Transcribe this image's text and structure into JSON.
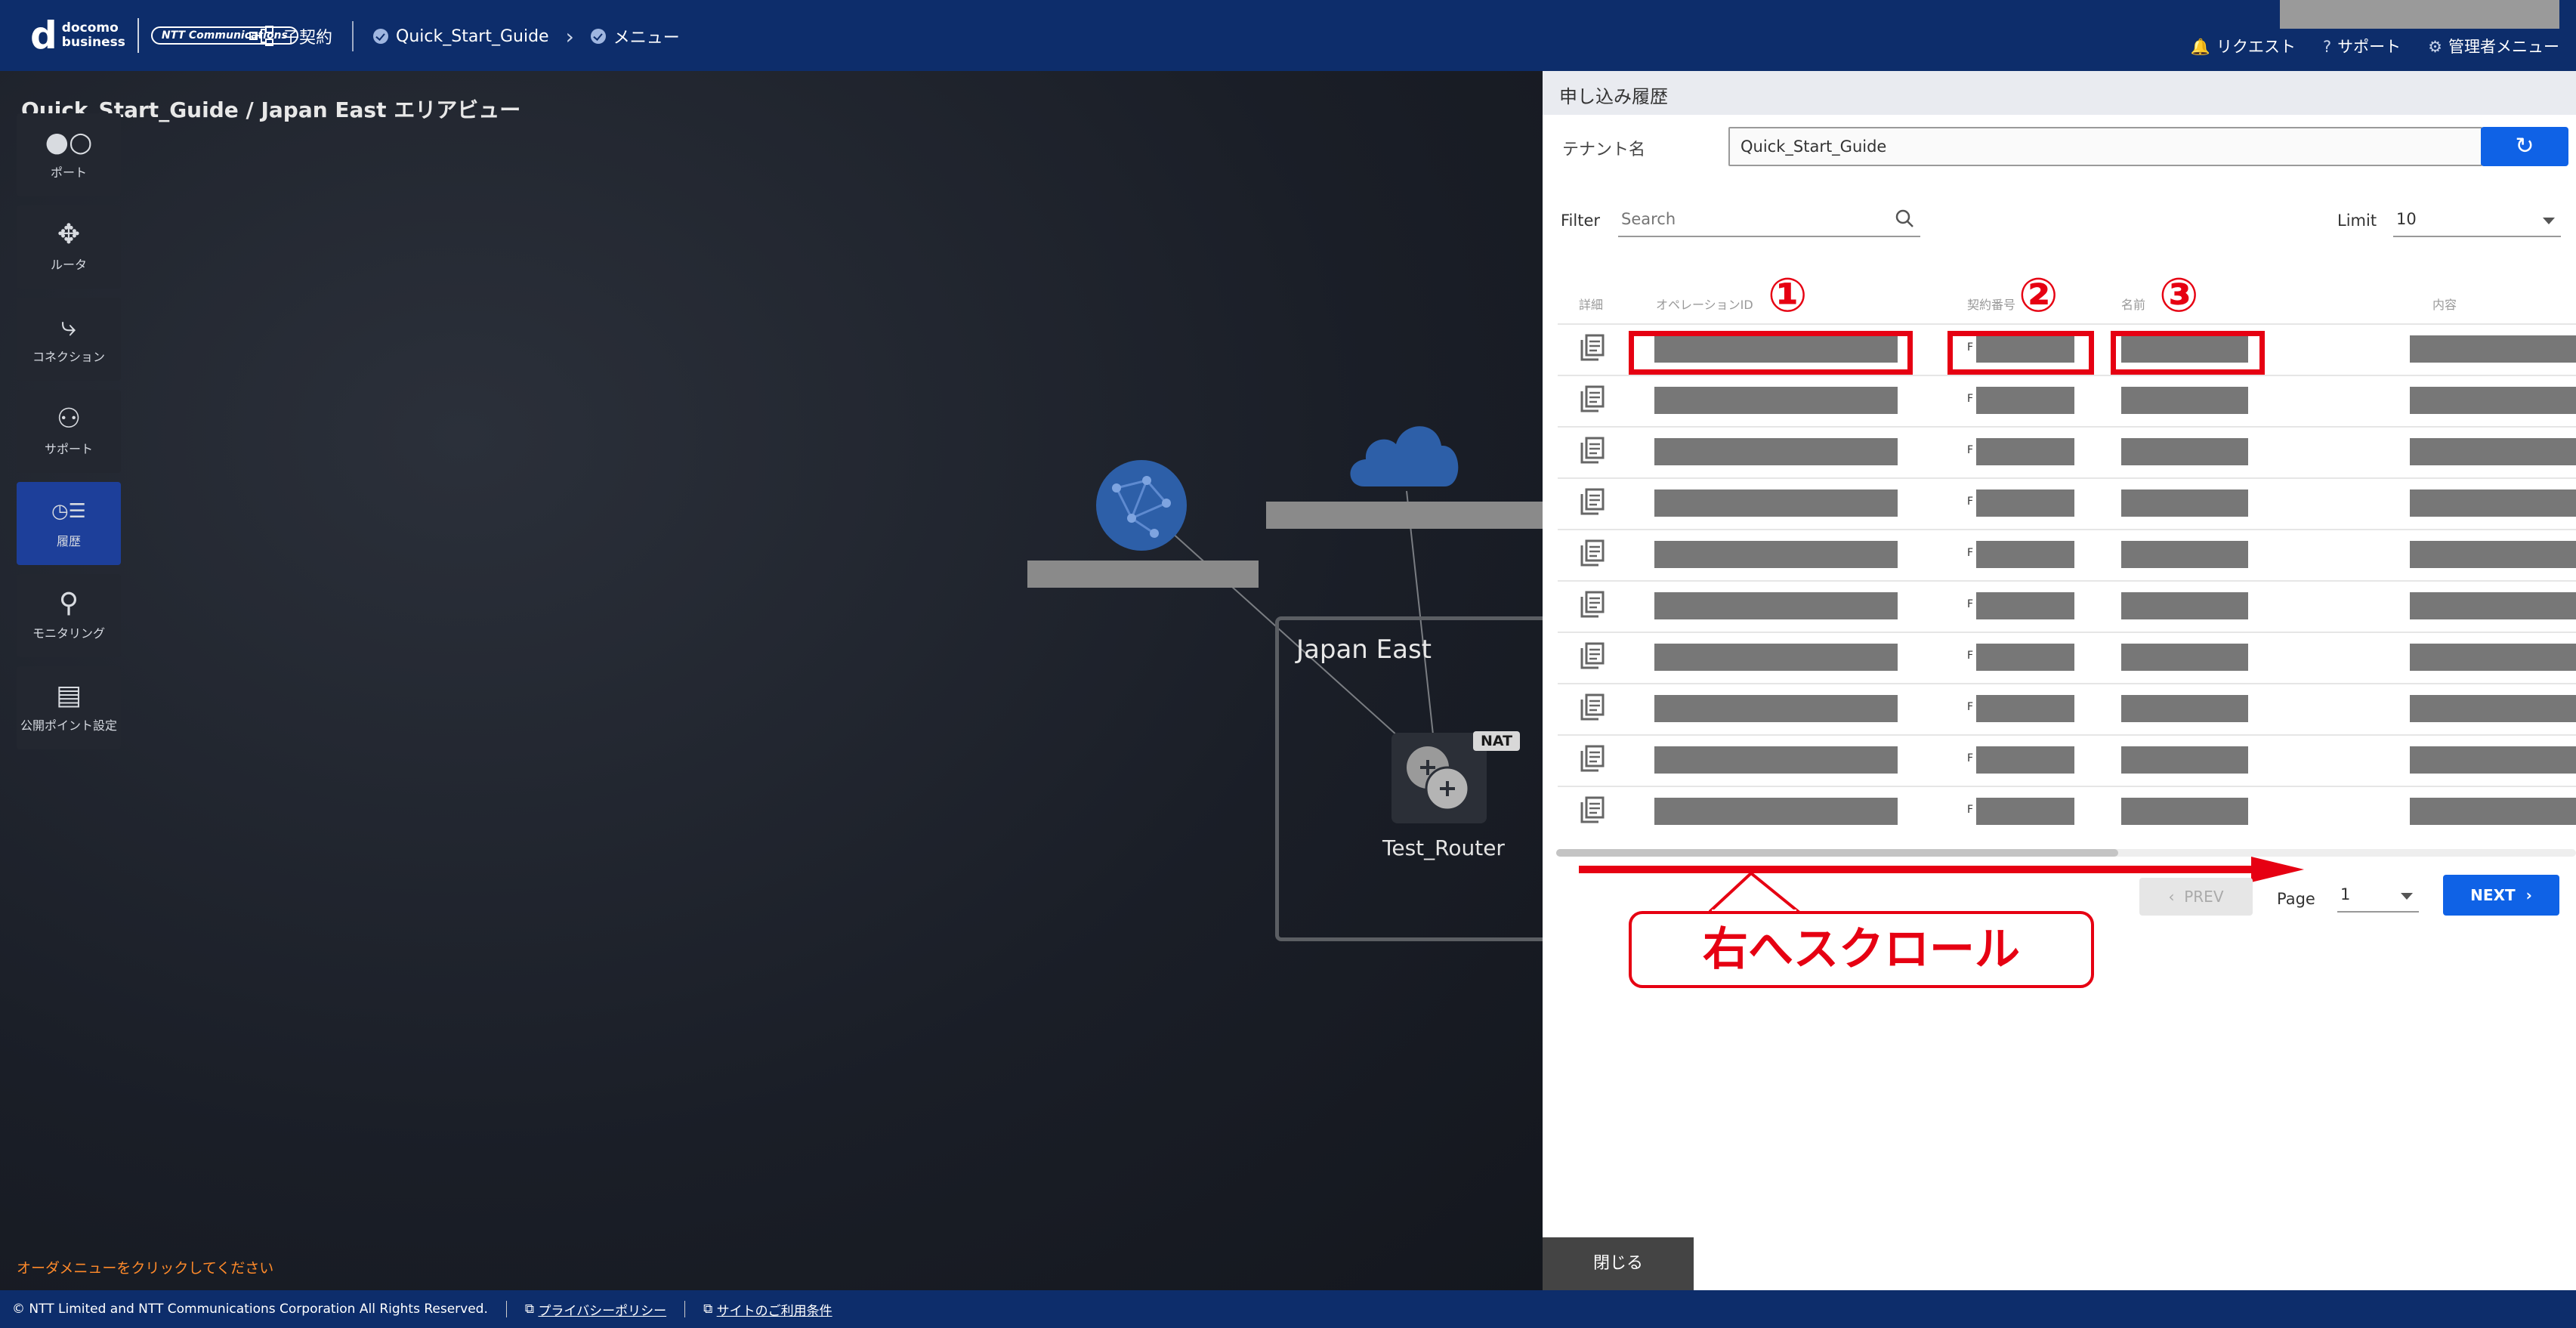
{
  "header": {
    "logo_line1": "docomo",
    "logo_line2": "business",
    "logo_ntt": "NTT Communications",
    "crumb_contract": "子契約",
    "crumb_tenant": "Quick_Start_Guide",
    "crumb_menu": "メニュー",
    "request": "リクエスト",
    "support": "サポート",
    "admin_menu": "管理者メニュー"
  },
  "page": {
    "title": "Quick_Start_Guide / Japan East エリアビュー",
    "hint": "オーダメニューをクリックしてください"
  },
  "sidebar": {
    "items": [
      {
        "label": "ポート",
        "icon": "port-icon"
      },
      {
        "label": "ルータ",
        "icon": "router-icon"
      },
      {
        "label": "コネクション",
        "icon": "connection-icon"
      },
      {
        "label": "サポート",
        "icon": "support-icon"
      },
      {
        "label": "履歴",
        "icon": "history-icon"
      },
      {
        "label": "モニタリング",
        "icon": "monitoring-icon"
      },
      {
        "label": "公開ポイント設定",
        "icon": "public-point-icon"
      }
    ]
  },
  "map": {
    "area_label": "Japan East",
    "router_name": "Test_Router",
    "nat_badge": "NAT"
  },
  "panel": {
    "title": "申し込み履歴",
    "tenant_label": "テナント名",
    "tenant_value": "Quick_Start_Guide",
    "filter_label": "Filter",
    "search_placeholder": "Search",
    "limit_label": "Limit",
    "limit_value": "10",
    "columns": [
      "詳細",
      "オペレーションID",
      "契約番号",
      "名前",
      "内容"
    ],
    "row_prefix": "F",
    "annotations": [
      "①",
      "②",
      "③"
    ],
    "callout": "右へスクロール",
    "prev": "PREV",
    "page_label": "Page",
    "page_value": "1",
    "next": "NEXT",
    "close": "閉じる"
  },
  "footer": {
    "copyright": "© NTT Limited and NTT Communications Corporation All Rights Reserved.",
    "privacy": "プライバシーポリシー",
    "terms": "サイトのご利用条件"
  },
  "colors": {
    "header_bg": "#0d2d6b",
    "primary": "#0f62e6",
    "annotation_red": "#e60012",
    "active_side": "#1d3f9a"
  }
}
